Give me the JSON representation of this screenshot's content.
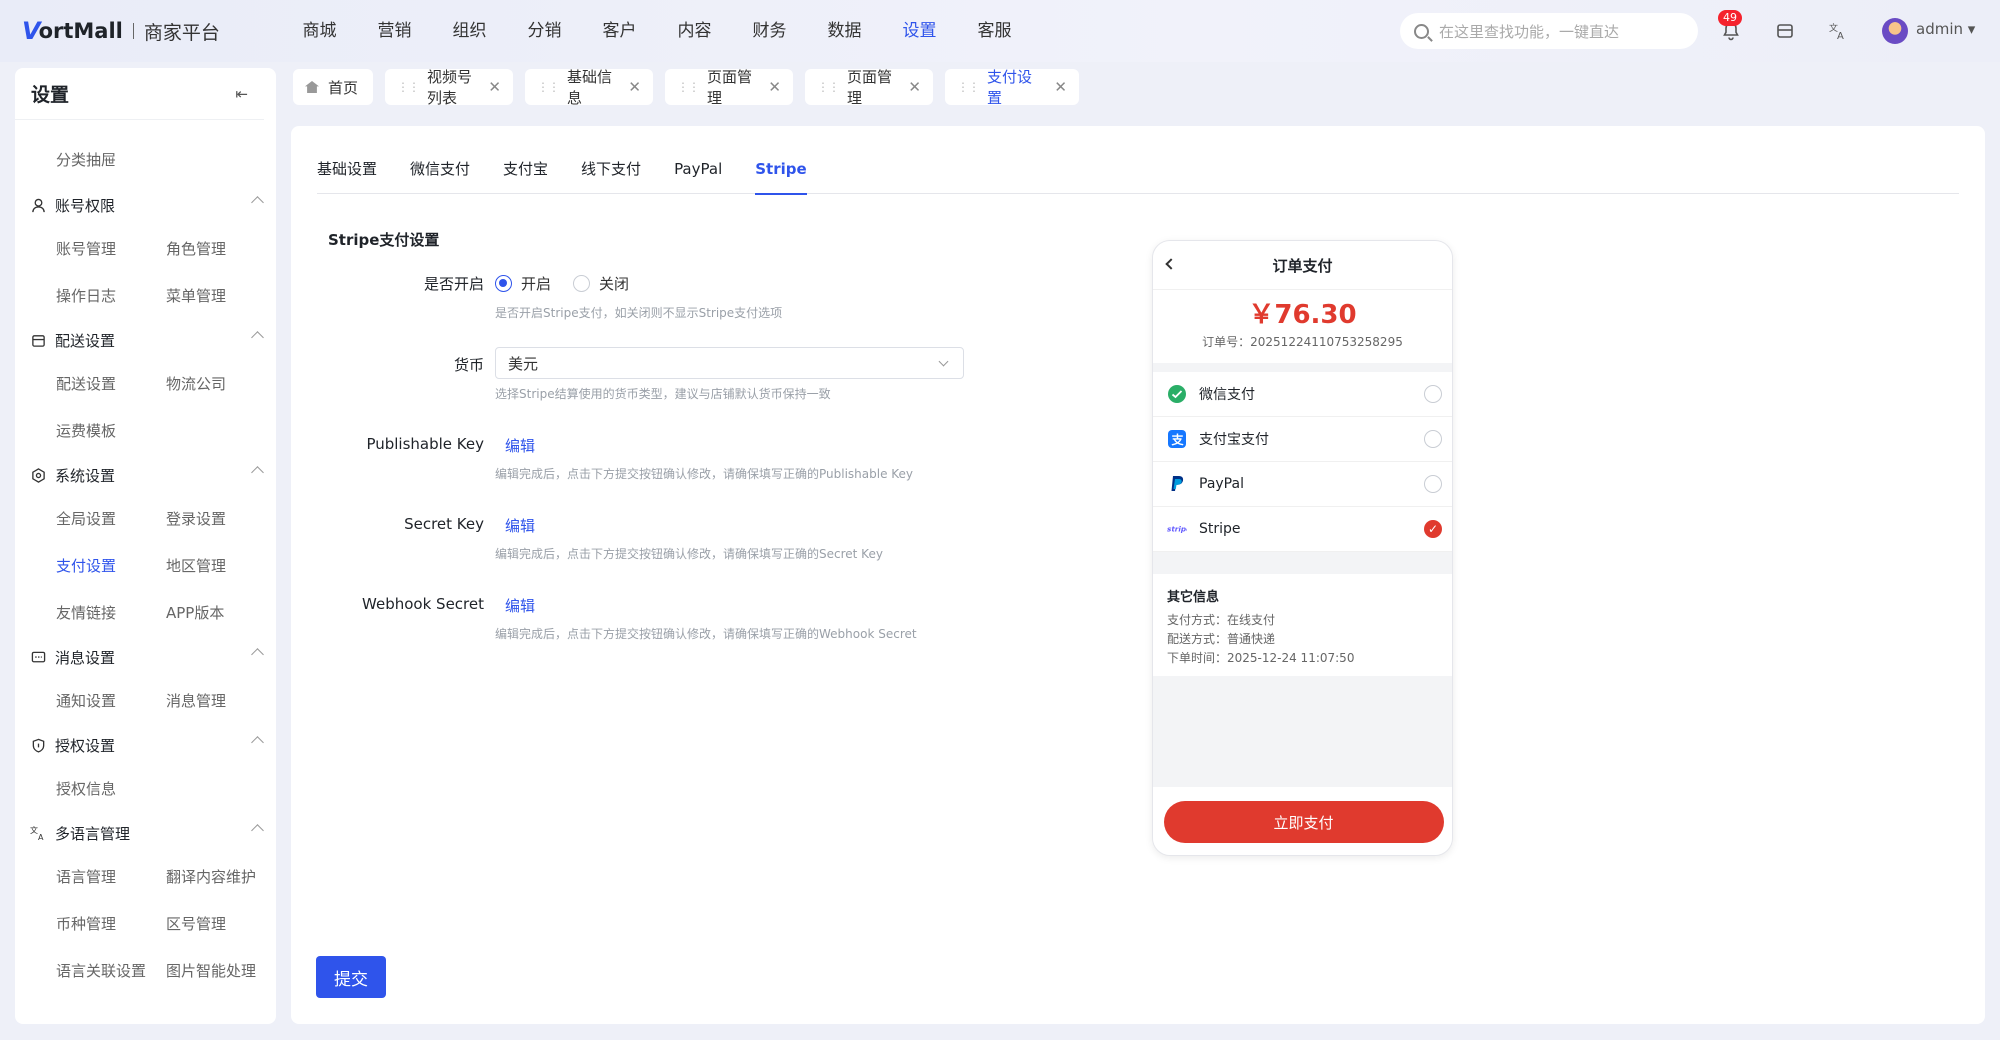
{
  "logo": {
    "v": "V",
    "brand": "ortMall",
    "sub": "商家平台"
  },
  "nav": [
    "商城",
    "营销",
    "组织",
    "分销",
    "客户",
    "内容",
    "财务",
    "数据",
    "设置",
    "客服"
  ],
  "nav_active_index": 8,
  "search": {
    "placeholder": "在这里查找功能，一键直达"
  },
  "notifications": {
    "count": "49"
  },
  "user": {
    "name": "admin ▾"
  },
  "sidebar": {
    "title": "设置",
    "top_item": "分类抽屉",
    "groups": [
      {
        "label": "账号权限",
        "icon": "user-icon",
        "items": [
          "账号管理",
          "角色管理",
          "操作日志",
          "菜单管理"
        ]
      },
      {
        "label": "配送设置",
        "icon": "box-icon",
        "items": [
          "配送设置",
          "物流公司",
          "运费模板"
        ]
      },
      {
        "label": "系统设置",
        "icon": "gear-icon",
        "items": [
          "全局设置",
          "登录设置",
          "支付设置",
          "地区管理",
          "友情链接",
          "APP版本"
        ]
      },
      {
        "label": "消息设置",
        "icon": "message-icon",
        "items": [
          "通知设置",
          "消息管理"
        ]
      },
      {
        "label": "授权设置",
        "icon": "shield-icon",
        "items": [
          "授权信息"
        ]
      },
      {
        "label": "多语言管理",
        "icon": "translate-icon",
        "items": [
          "语言管理",
          "翻译内容维护",
          "币种管理",
          "区号管理",
          "语言关联设置",
          "图片智能处理"
        ]
      }
    ],
    "active_item": "支付设置"
  },
  "tabs": [
    {
      "label": "首页"
    },
    {
      "label": "视频号列表"
    },
    {
      "label": "基础信息"
    },
    {
      "label": "页面管理"
    },
    {
      "label": "页面管理"
    },
    {
      "label": "支付设置",
      "active": true
    }
  ],
  "page_tabs": [
    "基础设置",
    "微信支付",
    "支付宝",
    "线下支付",
    "PayPal",
    "Stripe"
  ],
  "page_tab_active": "Stripe",
  "form": {
    "section_title": "Stripe支付设置",
    "enable": {
      "label": "是否开启",
      "on": "开启",
      "off": "关闭",
      "value": "开启",
      "help": "是否开启Stripe支付，如关闭则不显示Stripe支付选项"
    },
    "currency": {
      "label": "货币",
      "value": "美元",
      "help": "选择Stripe结算使用的货币类型，建议与店铺默认货币保持一致"
    },
    "publishable": {
      "label": "Publishable Key",
      "action": "编辑",
      "help": "编辑完成后，点击下方提交按钮确认修改，请确保填写正确的Publishable Key"
    },
    "secret": {
      "label": "Secret Key",
      "action": "编辑",
      "help": "编辑完成后，点击下方提交按钮确认修改，请确保填写正确的Secret Key"
    },
    "webhook": {
      "label": "Webhook Secret",
      "action": "编辑",
      "help": "编辑完成后，点击下方提交按钮确认修改，请确保填写正确的Webhook Secret"
    },
    "submit": "提交"
  },
  "preview": {
    "title": "订单支付",
    "amount": "￥76.30",
    "order_no": "订单号：20251224110753258295",
    "methods": [
      {
        "label": "微信支付",
        "icon": "wechat-pay-icon",
        "selected": false
      },
      {
        "label": "支付宝支付",
        "icon": "alipay-icon",
        "selected": false
      },
      {
        "label": "PayPal",
        "icon": "paypal-icon",
        "selected": false
      },
      {
        "label": "Stripe",
        "icon": "stripe-icon",
        "selected": true
      }
    ],
    "info_title": "其它信息",
    "info": [
      "支付方式：在线支付",
      "配送方式：普通快递",
      "下单时间：2025-12-24 11:07:50"
    ],
    "pay_button": "立即支付"
  },
  "colors": {
    "accent": "#2f54eb",
    "pay_red": "#e03a2e"
  }
}
